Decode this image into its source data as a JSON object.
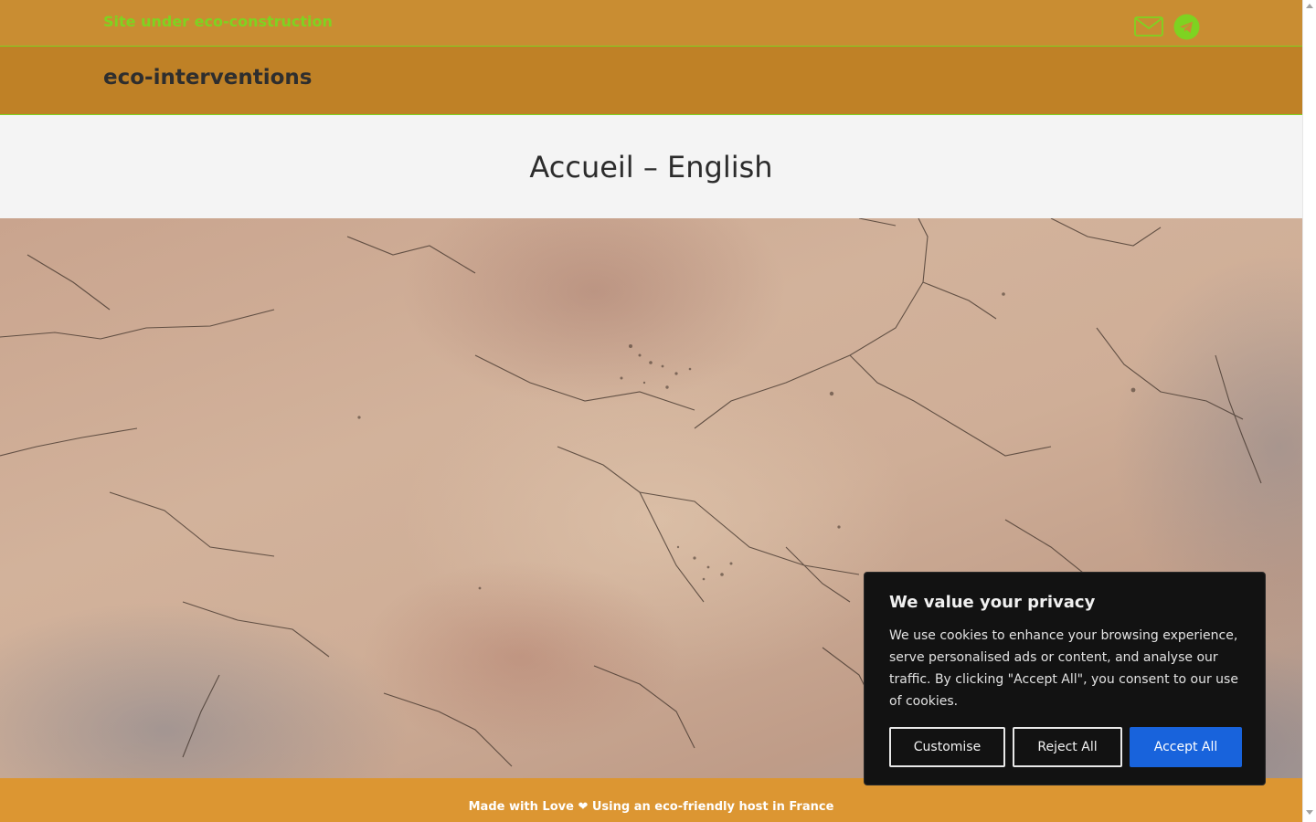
{
  "topbar": {
    "tagline": "Site under eco-construction",
    "icons": [
      "mail-icon",
      "telegram-icon"
    ]
  },
  "header": {
    "site_title": "eco-interventions"
  },
  "main": {
    "page_title": "Accueil – English",
    "hero_image": "cracked-plaster-wall-texture"
  },
  "footer": {
    "text": "Made with Love ❤ Using an eco-friendly host in France"
  },
  "cookie_banner": {
    "title": "We value your privacy",
    "body": "We use cookies to enhance your browsing experience, serve personalised ads or content, and analyse our traffic. By clicking \"Accept All\", you consent to our use of cookies.",
    "customise_label": "Customise",
    "reject_label": "Reject All",
    "accept_label": "Accept All"
  },
  "colors": {
    "topbar_bg": "#c98d32",
    "header_bg": "#bf8126",
    "accent_green": "#7ed321",
    "footer_bg": "#dc9632",
    "banner_bg": "#121212",
    "accept_blue": "#1863dc"
  }
}
